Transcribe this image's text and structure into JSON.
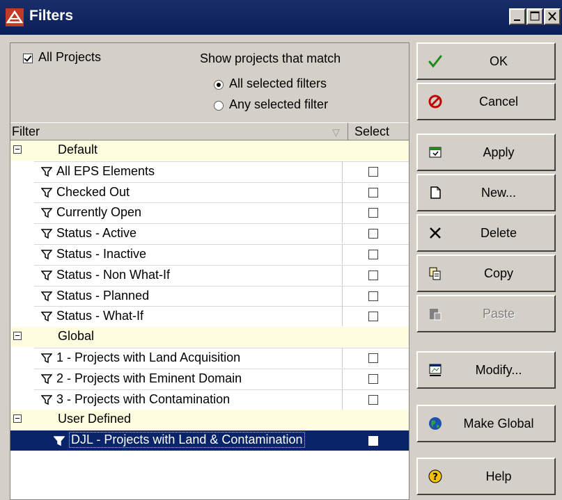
{
  "window": {
    "title": "Filters"
  },
  "top": {
    "all_projects_label": "All Projects",
    "all_projects_checked": true,
    "match_label": "Show projects that match",
    "radio_all": "All selected filters",
    "radio_any": "Any selected filter",
    "selected_radio": "all"
  },
  "grid": {
    "col_filter": "Filter",
    "col_select": "Select",
    "groups": [
      {
        "name": "Default",
        "items": [
          "All EPS Elements",
          "Checked Out",
          "Currently Open",
          "Status - Active",
          "Status - Inactive",
          "Status - Non What-If",
          "Status - Planned",
          "Status - What-If"
        ]
      },
      {
        "name": "Global",
        "items": [
          "1 - Projects with Land Acquisition",
          "2 - Projects with Eminent Domain",
          "3 - Projects with Contamination"
        ]
      },
      {
        "name": "User Defined",
        "items": [
          "DJL - Projects with Land & Contamination"
        ]
      }
    ],
    "selected_item": "DJL - Projects with Land & Contamination"
  },
  "buttons": {
    "ok": "OK",
    "cancel": "Cancel",
    "apply": "Apply",
    "new": "New...",
    "delete": "Delete",
    "copy": "Copy",
    "paste": "Paste",
    "modify": "Modify...",
    "make_global": "Make Global",
    "help": "Help"
  },
  "colors": {
    "title_bar": "#0a246a",
    "selection": "#0a246a",
    "group_row": "#fffde0",
    "face": "#d4d0c8"
  }
}
